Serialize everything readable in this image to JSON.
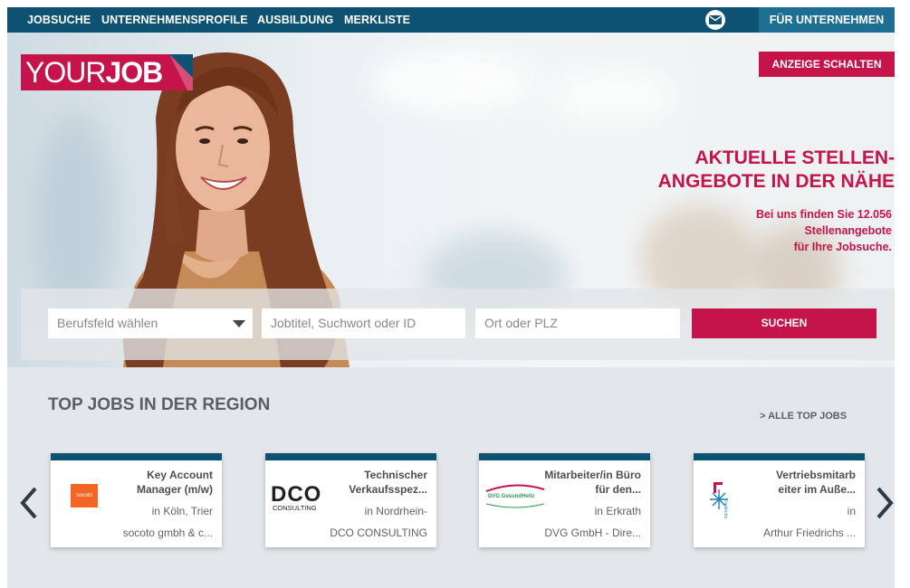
{
  "nav": {
    "items": [
      "JOBSUCHE",
      "UNTERNEHMENSPROFILE",
      "AUSBILDUNG",
      "MERKLISTE"
    ],
    "mail_icon": "envelope-icon",
    "employer_label": "FÜR UNTERNEHMEN"
  },
  "logo": {
    "part1": "YOUR",
    "part2": "JOB"
  },
  "hero": {
    "ad_button": "ANZEIGE SCHALTEN",
    "headline_line1": "AKTUELLE STELLEN-",
    "headline_line2": "ANGEBOTE IN DER NÄHE",
    "sub_line1": "Bei uns finden Sie 12.056",
    "sub_line2": "Stellenangebote",
    "sub_line3": "für Ihre Jobsuche."
  },
  "search": {
    "category_placeholder": "Berufsfeld wählen",
    "keyword_placeholder": "Jobtitel, Suchwort oder ID",
    "location_placeholder": "Ort oder PLZ",
    "button": "SUCHEN"
  },
  "topjobs": {
    "title": "TOP JOBS IN DER REGION",
    "all_link": "> ALLE TOP JOBS",
    "cards": [
      {
        "title": "Key Account Manager (m/w)",
        "location": "in Köln, Trier",
        "company": "socoto gmbh & c...",
        "logo_text": "socoto",
        "logo_color": "#f26522"
      },
      {
        "title": "Technischer Verkaufsspez...",
        "location": "in Nordrhein-",
        "company": "DCO CONSULTING",
        "logo_text": "DCO",
        "logo_sub": "CONSULTING"
      },
      {
        "title": "Mitarbeiter/in Büro für den...",
        "location": "in Erkrath",
        "company": "DVG GmbH - Dire...",
        "logo_text": "DVG GesundHeitz"
      },
      {
        "title": "Vertriebsmitarb eiter im Auße...",
        "location": "in",
        "company": "Arthur Friedrichs ...",
        "logo_text": "Friedrichs"
      }
    ]
  },
  "colors": {
    "nav_bg": "#0d5272",
    "accent": "#c4144a",
    "employer_bg": "#1d6e93"
  }
}
